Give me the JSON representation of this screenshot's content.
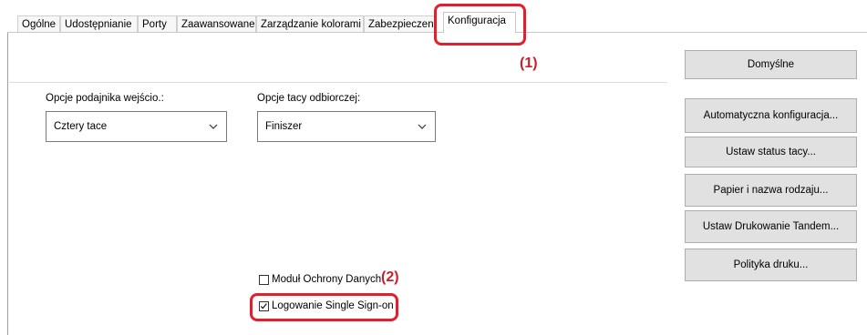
{
  "tabs": [
    {
      "label": "Ogólne"
    },
    {
      "label": "Udostępnianie"
    },
    {
      "label": "Porty"
    },
    {
      "label": "Zaawansowane"
    },
    {
      "label": "Zarządzanie kolorami"
    },
    {
      "label": "Zabezpieczen"
    },
    {
      "label": "Konfiguracja"
    }
  ],
  "callouts": {
    "one": "(1)",
    "two": "(2)"
  },
  "input_tray": {
    "label": "Opcje podajnika wejścio.:",
    "value": "Cztery tace"
  },
  "output_tray": {
    "label": "Opcje tacy odbiorczej:",
    "value": "Finiszer"
  },
  "checkboxes": {
    "data_security": {
      "label": "Moduł Ochrony Danych",
      "checked": false
    },
    "sso": {
      "label": "Logowanie Single Sign-on",
      "checked": true
    }
  },
  "buttons": {
    "defaults": "Domyślne",
    "auto_config": "Automatyczna konfiguracja...",
    "tray_status": "Ustaw status tacy...",
    "paper_type": "Papier i nazwa rodzaju...",
    "tandem": "Ustaw Drukowanie Tandem...",
    "print_policy": "Polityka druku..."
  },
  "colors": {
    "callout": "#e0202f",
    "callout_text": "#c8202a"
  }
}
